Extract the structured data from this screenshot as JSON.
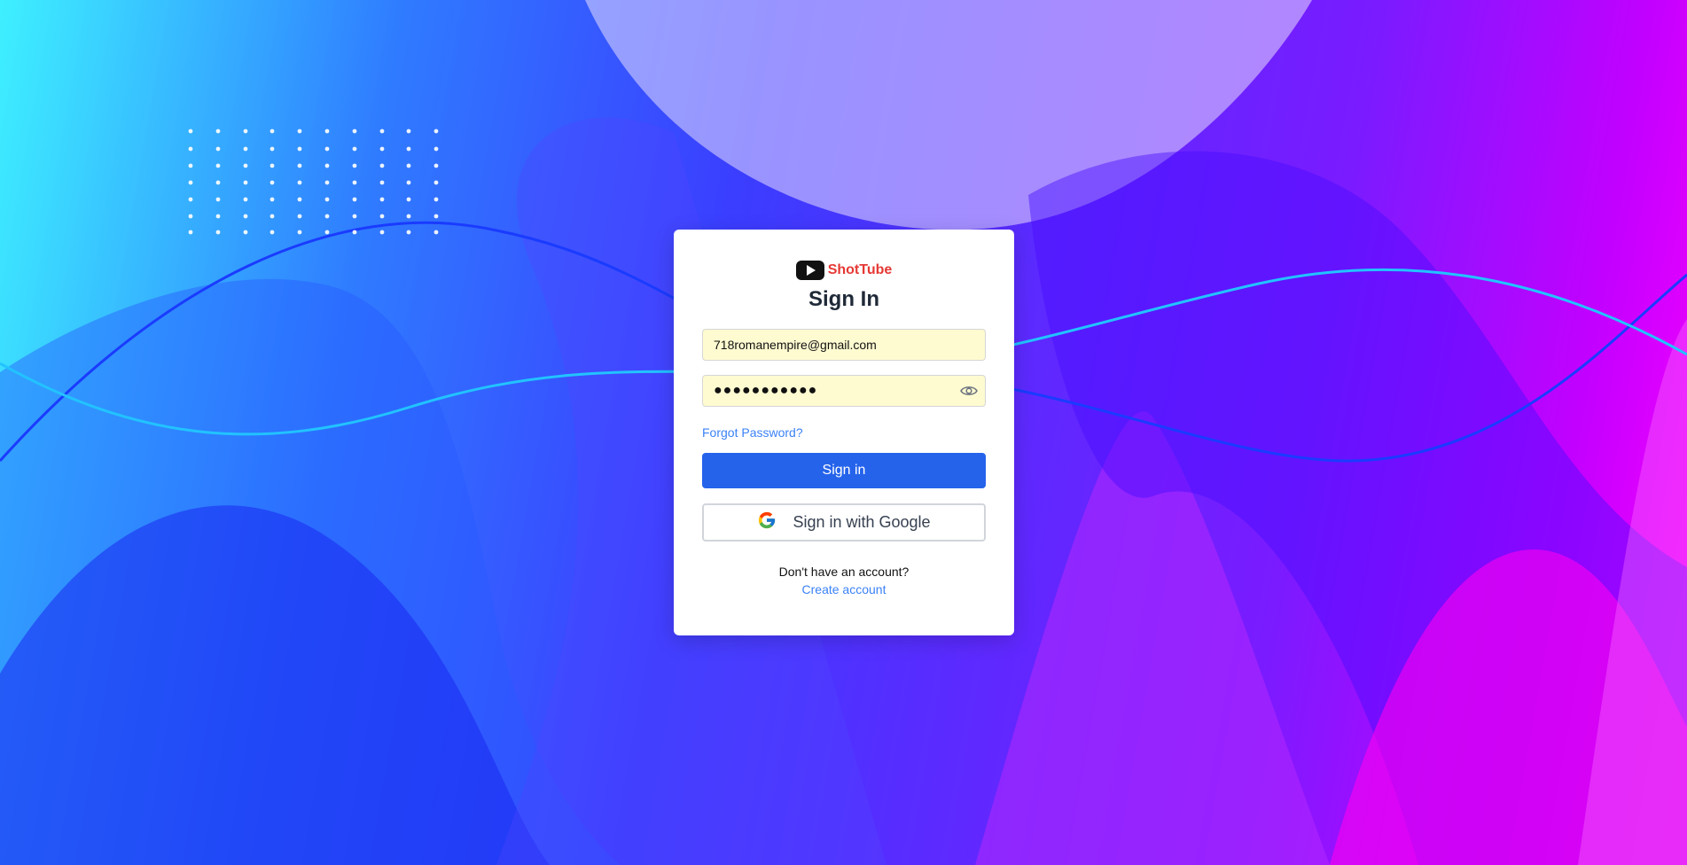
{
  "brand": {
    "name": "ShotTube",
    "logo_icon": "play-icon",
    "name_color": "#e53935"
  },
  "form": {
    "title": "Sign In",
    "email_value": "718romanempire@gmail.com",
    "password_mask": "●●●●●●●●●●●",
    "forgot_label": "Forgot Password?",
    "signin_label": "Sign in",
    "google_label": "Sign in with Google"
  },
  "footer": {
    "prompt": "Don't have an account?",
    "create_label": "Create account"
  },
  "colors": {
    "primary": "#2563eb",
    "link": "#3b82f6",
    "field_bg": "#fefbd0"
  }
}
